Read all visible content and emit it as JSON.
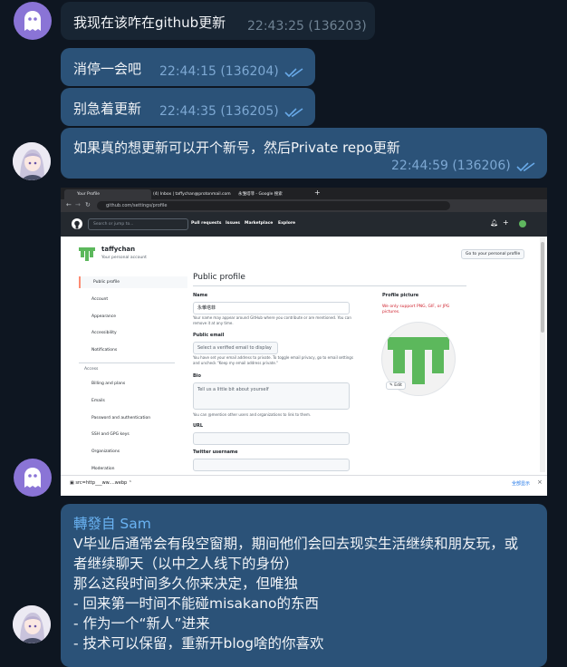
{
  "messages": [
    {
      "text": "我现在该咋在github更新",
      "time": "22:43:25 (136203)"
    },
    {
      "text": "消停一会吧",
      "time": "22:44:15 (136204)"
    },
    {
      "text": "别急着更新",
      "time": "22:44:35 (136205)"
    },
    {
      "text": "如果真的想更新可以开个新号，然后Private repo更新",
      "time": "22:44:59 (136206)"
    }
  ],
  "screenshot": {
    "tabs": [
      "Your Profile",
      "(4) Inbox | taffychan@protonmail.com",
      "永雏塔菲 - Google 搜索"
    ],
    "url": "github.com/settings/profile",
    "search_placeholder": "Search or jump to...",
    "nav_links": [
      "Pull requests",
      "Issues",
      "Marketplace",
      "Explore"
    ],
    "user_name": "taffychan",
    "user_subtitle": "Your personal account",
    "go_profile_button": "Go to your personal profile",
    "sidebar": [
      "Public profile",
      "Account",
      "Appearance",
      "Accessibility",
      "Notifications"
    ],
    "access_heading": "Access",
    "access_items": [
      "Billing and plans",
      "Emails",
      "Password and authentication",
      "SSH and GPG keys",
      "Organizations",
      "Moderation"
    ],
    "heading": "Public profile",
    "name_label": "Name",
    "name_value": "永雏塔菲",
    "name_note": "Your name may appear around GitHub where you contribute or are mentioned. You can remove it at any time.",
    "email_label": "Public email",
    "email_value": "Select a verified email to display",
    "email_note": "You have set your email address to private. To toggle email privacy, go to email settings and uncheck \"Keep my email address private.\"",
    "bio_label": "Bio",
    "bio_placeholder": "Tell us a little bit about yourself",
    "bio_note": "You can @mention other users and organizations to link to them.",
    "url_label": "URL",
    "twitter_label": "Twitter username",
    "picture_label": "Profile picture",
    "picture_note": "We only support PNG, GIF, or JPG pictures.",
    "edit_label": "Edit",
    "download_file": "src=http___ww....webp",
    "show_all": "全部显示"
  },
  "forward": {
    "header": "轉發自 Sam",
    "lines": [
      "V毕业后通常会有段空窗期，期间他们会回去现实生活继续和朋友玩，或",
      "者继续聊天（以中之人线下的身份）",
      "那么这段时间多久你来决定，但唯独",
      "- 回来第一时间不能碰misakano的东西",
      "- 作为一个“新人”进来",
      "- 技术可以保留，重新开blog啥的你喜欢"
    ]
  },
  "colors": {
    "background": "#0e1621",
    "incoming": "#182533",
    "outgoing": "#2b5278",
    "forward_name": "#6ab3f3",
    "read_check": "#68a9e8"
  }
}
